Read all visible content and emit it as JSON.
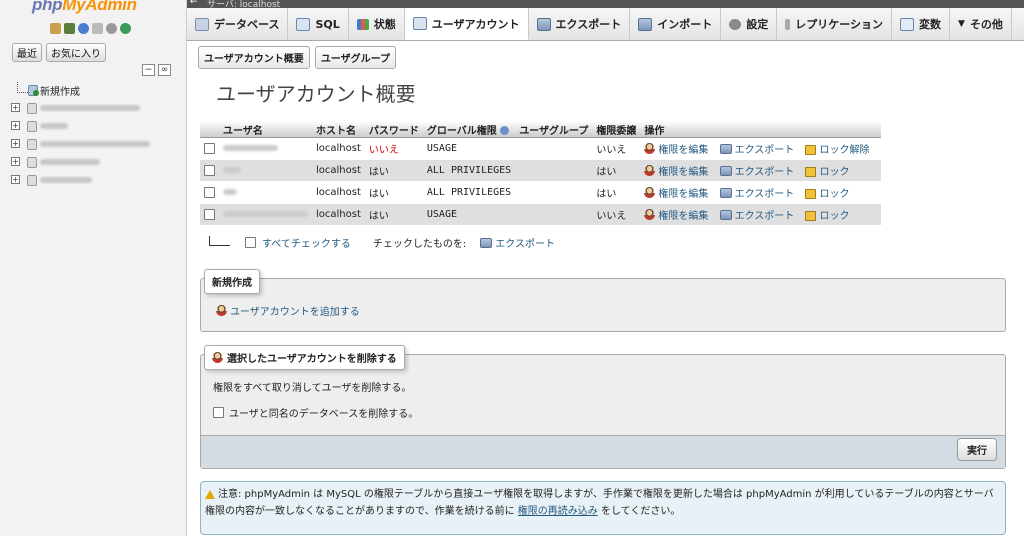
{
  "logo": {
    "part1": "php",
    "part2": "MyAdmin"
  },
  "sidebar": {
    "buttons": [
      "最近",
      "お気に入り"
    ],
    "new_label": "新規作成",
    "databases": [
      "",
      "",
      "",
      "",
      ""
    ]
  },
  "topbar": {
    "server": "サーバ: localhost"
  },
  "tabs": [
    {
      "label": "データベース",
      "icon": "database-icon"
    },
    {
      "label": "SQL",
      "icon": "sql-icon"
    },
    {
      "label": "状態",
      "icon": "status-icon"
    },
    {
      "label": "ユーザアカウント",
      "icon": "users-icon"
    },
    {
      "label": "エクスポート",
      "icon": "export-icon"
    },
    {
      "label": "インポート",
      "icon": "import-icon"
    },
    {
      "label": "設定",
      "icon": "settings-icon"
    },
    {
      "label": "レプリケーション",
      "icon": "replication-icon"
    },
    {
      "label": "変数",
      "icon": "variables-icon"
    },
    {
      "label": "その他",
      "icon": "more-icon"
    }
  ],
  "subtabs": [
    "ユーザアカウント概要",
    "ユーザグループ"
  ],
  "title": "ユーザアカウント概要",
  "table": {
    "headers": [
      "ユーザ名",
      "ホスト名",
      "パスワード",
      "グローバル権限",
      "ユーザグループ",
      "権限委譲",
      "操作"
    ],
    "rows": [
      {
        "host": "localhost",
        "password": "いいえ",
        "privileges": "USAGE",
        "grant": "いいえ",
        "edit": "権限を編集",
        "export": "エクスポート",
        "lock": "ロック解除"
      },
      {
        "host": "localhost",
        "password": "はい",
        "privileges": "ALL PRIVILEGES",
        "grant": "はい",
        "edit": "権限を編集",
        "export": "エクスポート",
        "lock": "ロック"
      },
      {
        "host": "localhost",
        "password": "はい",
        "privileges": "ALL PRIVILEGES",
        "grant": "はい",
        "edit": "権限を編集",
        "export": "エクスポート",
        "lock": "ロック"
      },
      {
        "host": "localhost",
        "password": "はい",
        "privileges": "USAGE",
        "grant": "いいえ",
        "edit": "権限を編集",
        "export": "エクスポート",
        "lock": "ロック"
      }
    ]
  },
  "bulk": {
    "check_all": "すべてチェックする",
    "with_selected": "チェックしたものを:",
    "export": "エクスポート"
  },
  "new_section": {
    "legend": "新規作成",
    "add_user": "ユーザアカウントを追加する"
  },
  "delete_section": {
    "legend": "選択したユーザアカウントを削除する",
    "description": "権限をすべて取り消してユーザを削除する。",
    "drop_db": "ユーザと同名のデータベースを削除する。",
    "go": "実行"
  },
  "notice": {
    "text1": "注意: phpMyAdmin は MySQL の権限テーブルから直接ユーザ権限を取得しますが、手作業で権限を更新した場合は phpMyAdmin が利用しているテーブルの内容とサーバ権限の内容が一致しなくなることがありますので、作業を続ける前に",
    "link": "権限の再読み込み",
    "text2": "をしてください。"
  }
}
